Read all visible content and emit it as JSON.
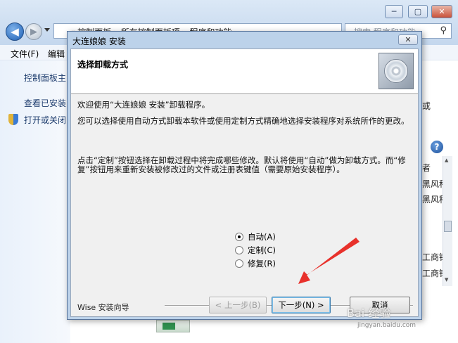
{
  "explorer": {
    "address": "« 控制面板 ▸ 所有控制面板项 ▸ 程序和功能",
    "search_placeholder": "搜索 程序和功能",
    "menu": [
      "文件(F)",
      "编辑"
    ],
    "window_controls": [
      "─",
      "▢",
      "✕"
    ],
    "left_links": [
      "控制面板主",
      "查看已安装",
      "打开或关闭"
    ],
    "right_fragments": [
      "或",
      "者",
      "黑风科",
      "黑风科",
      "工商银",
      "工商银"
    ]
  },
  "dialog": {
    "title": "大连娘娘 安装",
    "close_label": "✕",
    "header_title": "选择卸载方式",
    "welcome": "欢迎使用“大连娘娘 安装”卸载程序。",
    "description": "您可以选择使用自动方式卸载本软件或使用定制方式精确地选择安装程序对系统所作的更改。",
    "instructions": "点击“定制”按钮选择在卸载过程中将完成哪些修改。默认将使用“自动”做为卸载方式。而“修复”按钮用来重新安装被修改过的文件或注册表键值（需要原始安装程序）。",
    "options": [
      {
        "label": "自动(A)",
        "selected": true
      },
      {
        "label": "定制(C)",
        "selected": false
      },
      {
        "label": "修复(R)",
        "selected": false
      }
    ],
    "wizard_label": "Wise 安装向导",
    "buttons": {
      "back": "< 上一步(B)",
      "next": "下一步(N) >",
      "cancel": "取消"
    }
  },
  "watermark": {
    "text": "Bai 经验",
    "url": "jingyan.baidu.com"
  },
  "colors": {
    "arrow": "#e8312b",
    "dialog_frame": "#bcd2ea",
    "body_bg": "#f0f0f0"
  }
}
